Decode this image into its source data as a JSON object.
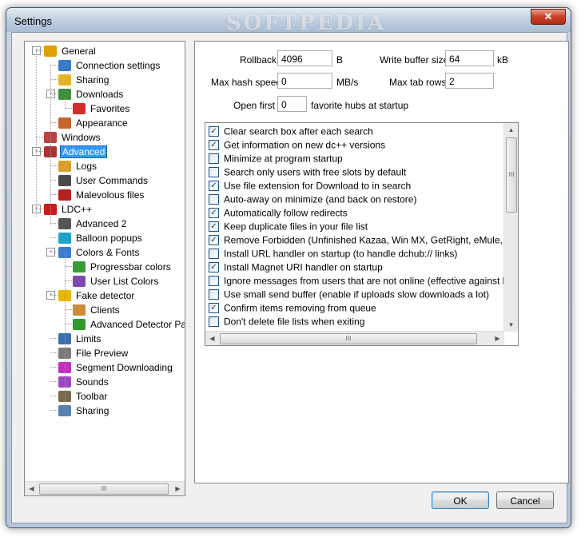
{
  "window": {
    "title": "Settings",
    "watermark": "SOFTPEDIA",
    "close_glyph": "✕"
  },
  "tree": {
    "items": [
      {
        "label": "General",
        "icon": "gear-icon",
        "color": "#e0a000",
        "level": 0,
        "expander": "-",
        "name": "tree-item-general"
      },
      {
        "label": "Connection settings",
        "icon": "network-icon",
        "color": "#3a7ac9",
        "level": 1,
        "name": "tree-item-connection-settings"
      },
      {
        "label": "Sharing",
        "icon": "folder-icon",
        "color": "#e4b42a",
        "level": 1,
        "name": "tree-item-sharing"
      },
      {
        "label": "Downloads",
        "icon": "download-icon",
        "color": "#3f8f3f",
        "level": 1,
        "expander": "-",
        "name": "tree-item-downloads"
      },
      {
        "label": "Favorites",
        "icon": "heart-icon",
        "color": "#d62c2c",
        "level": 2,
        "name": "tree-item-favorites"
      },
      {
        "label": "Appearance",
        "icon": "paint-icon",
        "color": "#c8652a",
        "level": 1,
        "name": "tree-item-appearance"
      },
      {
        "label": "Windows",
        "icon": "windows-icon",
        "color": "#c04040",
        "level": 0,
        "name": "tree-item-windows"
      },
      {
        "label": "Advanced",
        "icon": "wrench-icon",
        "color": "#b03030",
        "level": 0,
        "expander": "-",
        "selected": true,
        "name": "tree-item-advanced"
      },
      {
        "label": "Logs",
        "icon": "log-icon",
        "color": "#d9a12b",
        "level": 1,
        "name": "tree-item-logs"
      },
      {
        "label": "User Commands",
        "icon": "command-icon",
        "color": "#4a4a4a",
        "level": 1,
        "name": "tree-item-user-commands"
      },
      {
        "label": "Malevolous files",
        "icon": "warning-file-icon",
        "color": "#b82020",
        "level": 1,
        "name": "tree-item-malevolous-files"
      },
      {
        "label": "LDC++",
        "icon": "ldc-icon",
        "color": "#cc1a1a",
        "level": 0,
        "expander": "-",
        "name": "tree-item-ldc"
      },
      {
        "label": "Advanced 2",
        "icon": "gear-icon",
        "color": "#555555",
        "level": 1,
        "name": "tree-item-advanced-2"
      },
      {
        "label": "Balloon popups",
        "icon": "balloon-icon",
        "color": "#21a3c9",
        "level": 1,
        "name": "tree-item-balloon-popups"
      },
      {
        "label": "Colors & Fonts",
        "icon": "palette-icon",
        "color": "#3b7bd0",
        "level": 1,
        "expander": "-",
        "name": "tree-item-colors-fonts"
      },
      {
        "label": "Progressbar colors",
        "icon": "progressbar-icon",
        "color": "#3a9a3a",
        "level": 2,
        "name": "tree-item-progressbar-colors"
      },
      {
        "label": "User List Colors",
        "icon": "userlist-icon",
        "color": "#7a4ab0",
        "level": 2,
        "name": "tree-item-user-list-colors"
      },
      {
        "label": "Fake detector",
        "icon": "warning-icon",
        "color": "#e6b800",
        "level": 1,
        "expander": "-",
        "name": "tree-item-fake-detector"
      },
      {
        "label": "Clients",
        "icon": "user-icon",
        "color": "#d08a3a",
        "level": 2,
        "name": "tree-item-clients"
      },
      {
        "label": "Advanced Detector Pa",
        "icon": "runner-icon",
        "color": "#2e9a2e",
        "level": 2,
        "name": "tree-item-advanced-detector"
      },
      {
        "label": "Limits",
        "icon": "gauge-icon",
        "color": "#3a6fb0",
        "level": 1,
        "name": "tree-item-limits"
      },
      {
        "label": "File Preview",
        "icon": "preview-icon",
        "color": "#7a7a7a",
        "level": 1,
        "name": "tree-item-file-preview"
      },
      {
        "label": "Segment Downloading",
        "icon": "segment-icon",
        "color": "#c02fc0",
        "level": 1,
        "name": "tree-item-segment-downloading"
      },
      {
        "label": "Sounds",
        "icon": "sound-icon",
        "color": "#9a4ac0",
        "level": 1,
        "name": "tree-item-sounds"
      },
      {
        "label": "Toolbar",
        "icon": "toolbar-icon",
        "color": "#7a6a50",
        "level": 1,
        "name": "tree-item-toolbar"
      },
      {
        "label": "Sharing",
        "icon": "folder-icon",
        "color": "#5a80b0",
        "level": 1,
        "name": "tree-item-sharing-2"
      }
    ],
    "hscroll_left": "◀",
    "hscroll_right": "▶",
    "hscroll_grip": "III"
  },
  "fields": {
    "rollback": {
      "label": "Rollback",
      "value": "4096",
      "unit": "B"
    },
    "write_buffer": {
      "label": "Write buffer size",
      "value": "64",
      "unit": "kB"
    },
    "max_hash": {
      "label": "Max hash speed",
      "value": "0",
      "unit": "MB/s"
    },
    "max_tab_rows": {
      "label": "Max tab rows",
      "value": "2"
    },
    "open_first": {
      "label": "Open first",
      "value": "0",
      "suffix": "favorite hubs at startup"
    }
  },
  "options": [
    {
      "label": "Clear search box after each search",
      "checked": true
    },
    {
      "label": "Get information on new dc++ versions",
      "checked": true
    },
    {
      "label": "Minimize at program startup",
      "checked": false
    },
    {
      "label": "Search only users with free slots by default",
      "checked": false
    },
    {
      "label": "Use file extension for Download to in search",
      "checked": true
    },
    {
      "label": "Auto-away on minimize (and back on restore)",
      "checked": false
    },
    {
      "label": "Automatically follow redirects",
      "checked": true
    },
    {
      "label": "Keep duplicate files in your file list",
      "checked": true
    },
    {
      "label": "Remove Forbidden (Unfinished Kazaa, Win MX, GetRight, eMule, LDC++)",
      "checked": true
    },
    {
      "label": "Install URL handler on startup (to handle dchub:// links)",
      "checked": false
    },
    {
      "label": "Install Magnet URI handler on startup",
      "checked": true
    },
    {
      "label": "Ignore messages from users that are not online (effective against bots)",
      "checked": false
    },
    {
      "label": "Use small send buffer (enable if uploads slow downloads a lot)",
      "checked": false
    },
    {
      "label": "Confirm items removing from queue",
      "checked": true
    },
    {
      "label": "Don't delete file lists when exiting",
      "checked": false
    }
  ],
  "options_scroll": {
    "up": "▲",
    "down": "▼",
    "left": "◀",
    "right": "▶",
    "grip": "III"
  },
  "buttons": {
    "ok": "OK",
    "cancel": "Cancel"
  }
}
